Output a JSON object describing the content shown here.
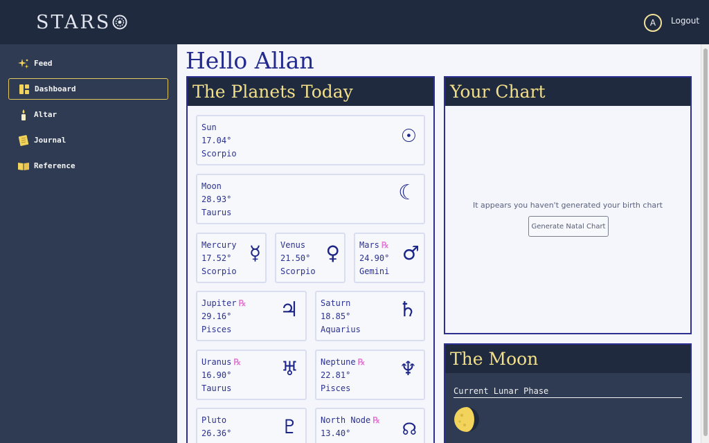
{
  "app": {
    "brand": "STARS",
    "brand_icon": "sun-disc-icon"
  },
  "user": {
    "avatar_initial": "A",
    "logout_label": "Logout"
  },
  "sidebar": {
    "items": [
      {
        "label": "Feed",
        "icon": "sparkles-icon",
        "active": false
      },
      {
        "label": "Dashboard",
        "icon": "dashboard-icon",
        "active": true
      },
      {
        "label": "Altar",
        "icon": "candle-icon",
        "active": false
      },
      {
        "label": "Journal",
        "icon": "journal-icon",
        "active": false
      },
      {
        "label": "Reference",
        "icon": "book-icon",
        "active": false
      }
    ]
  },
  "main": {
    "greeting": "Hello Allan"
  },
  "planets_panel": {
    "title": "The Planets Today",
    "retrograde_mark": "℞",
    "planets": [
      {
        "name": "Sun",
        "degree": "17.04°",
        "sign": "Scorpio",
        "glyph": "☉",
        "retrograde": false
      },
      {
        "name": "Moon",
        "degree": "28.93°",
        "sign": "Taurus",
        "glyph": "☾",
        "retrograde": false
      },
      {
        "name": "Mercury",
        "degree": "17.52°",
        "sign": "Scorpio",
        "glyph": "☿",
        "retrograde": false
      },
      {
        "name": "Venus",
        "degree": "21.50°",
        "sign": "Scorpio",
        "glyph": "♀",
        "retrograde": false
      },
      {
        "name": "Mars",
        "degree": "24.90°",
        "sign": "Gemini",
        "glyph": "♂",
        "retrograde": true
      },
      {
        "name": "Jupiter",
        "degree": "29.16°",
        "sign": "Pisces",
        "glyph": "♃",
        "retrograde": true
      },
      {
        "name": "Saturn",
        "degree": "18.85°",
        "sign": "Aquarius",
        "glyph": "♄",
        "retrograde": false
      },
      {
        "name": "Uranus",
        "degree": "16.90°",
        "sign": "Taurus",
        "glyph": "♅",
        "retrograde": true
      },
      {
        "name": "Neptune",
        "degree": "22.81°",
        "sign": "Pisces",
        "glyph": "♆",
        "retrograde": true
      },
      {
        "name": "Pluto",
        "degree": "26.36°",
        "sign": "",
        "glyph": "♇",
        "retrograde": false
      },
      {
        "name": "North Node",
        "degree": "13.40°",
        "sign": "",
        "glyph": "☊",
        "retrograde": true
      }
    ]
  },
  "chart_panel": {
    "title": "Your Chart",
    "message": "It appears you haven't generated your birth chart",
    "button_label": "Generate Natal Chart"
  },
  "moon_panel": {
    "title": "The Moon",
    "phase_label": "Current Lunar Phase",
    "phase_icon": "waning-gibbous-moon-icon"
  },
  "colors": {
    "topbar": "#1f2a3f",
    "sidebar": "#2e3b52",
    "accent_gold": "#f2df8a",
    "text_blue": "#2b3191",
    "retrograde_pink": "#e27ad3"
  }
}
